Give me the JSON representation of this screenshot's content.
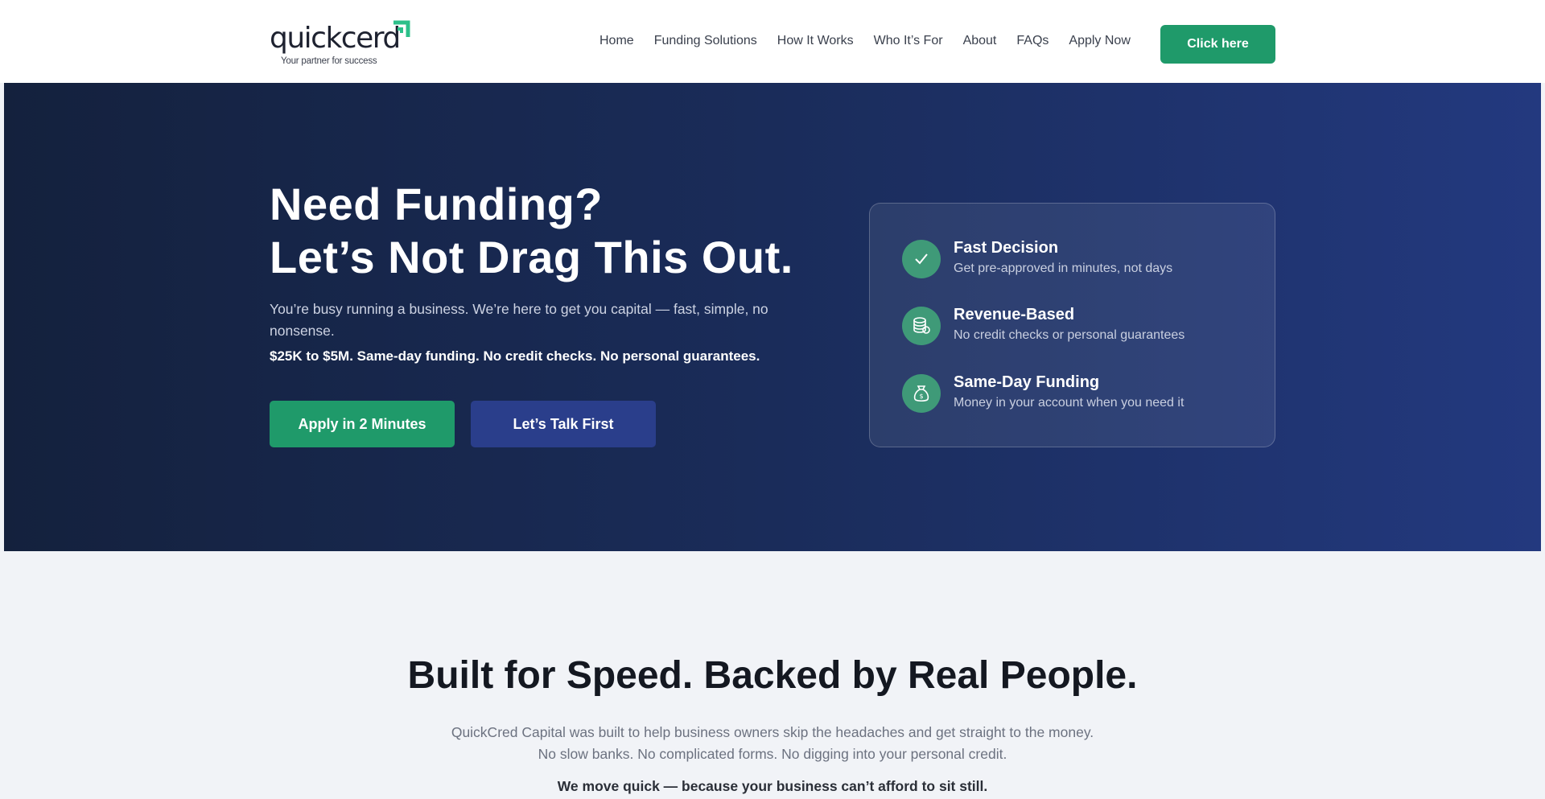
{
  "brand": {
    "name": "quickcerd",
    "tagline": "Your partner for success",
    "accent": "#1f9a6a",
    "navy": "#1a2c5a"
  },
  "nav": {
    "items": [
      "Home",
      "Funding Solutions",
      "How It Works",
      "Who It’s For",
      "About",
      "FAQs",
      "Apply Now"
    ],
    "cta": "Click here"
  },
  "hero": {
    "title_line1": "Need Funding?",
    "title_line2": "Let’s Not Drag This Out.",
    "subtitle": "You’re busy running a business. We’re here to get you capital — fast, simple, no nonsense.",
    "highlight": "$25K to $5M. Same-day funding. No credit checks. No personal guarantees.",
    "primary_button": "Apply in 2 Minutes",
    "secondary_button": "Let’s Talk First"
  },
  "features": [
    {
      "icon": "check-icon",
      "title": "Fast Decision",
      "desc": "Get pre-approved in minutes, not days"
    },
    {
      "icon": "coins-icon",
      "title": "Revenue-Based",
      "desc": "No credit checks or personal guarantees"
    },
    {
      "icon": "money-bag-icon",
      "title": "Same-Day Funding",
      "desc": "Money in your account when you need it"
    }
  ],
  "about": {
    "title": "Built for Speed. Backed by Real People.",
    "text": "QuickCred Capital was built to help business owners skip the headaches and get straight to the money. No slow banks. No complicated forms. No digging into your personal credit.",
    "strong": "We move quick — because your business can’t afford to sit still."
  }
}
